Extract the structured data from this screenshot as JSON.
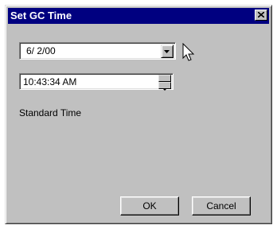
{
  "window": {
    "title": "Set GC Time"
  },
  "date_picker": {
    "value": "6/ 2/00"
  },
  "time_field": {
    "value": "10:43:34 AM"
  },
  "timezone_label": "Standard Time",
  "buttons": {
    "ok": "OK",
    "cancel": "Cancel"
  },
  "icons": {
    "close": "close-icon",
    "dropdown": "chevron-down-icon",
    "spin_up": "arrow-up-icon",
    "spin_down": "arrow-down-icon",
    "cursor": "mouse-pointer-icon"
  }
}
